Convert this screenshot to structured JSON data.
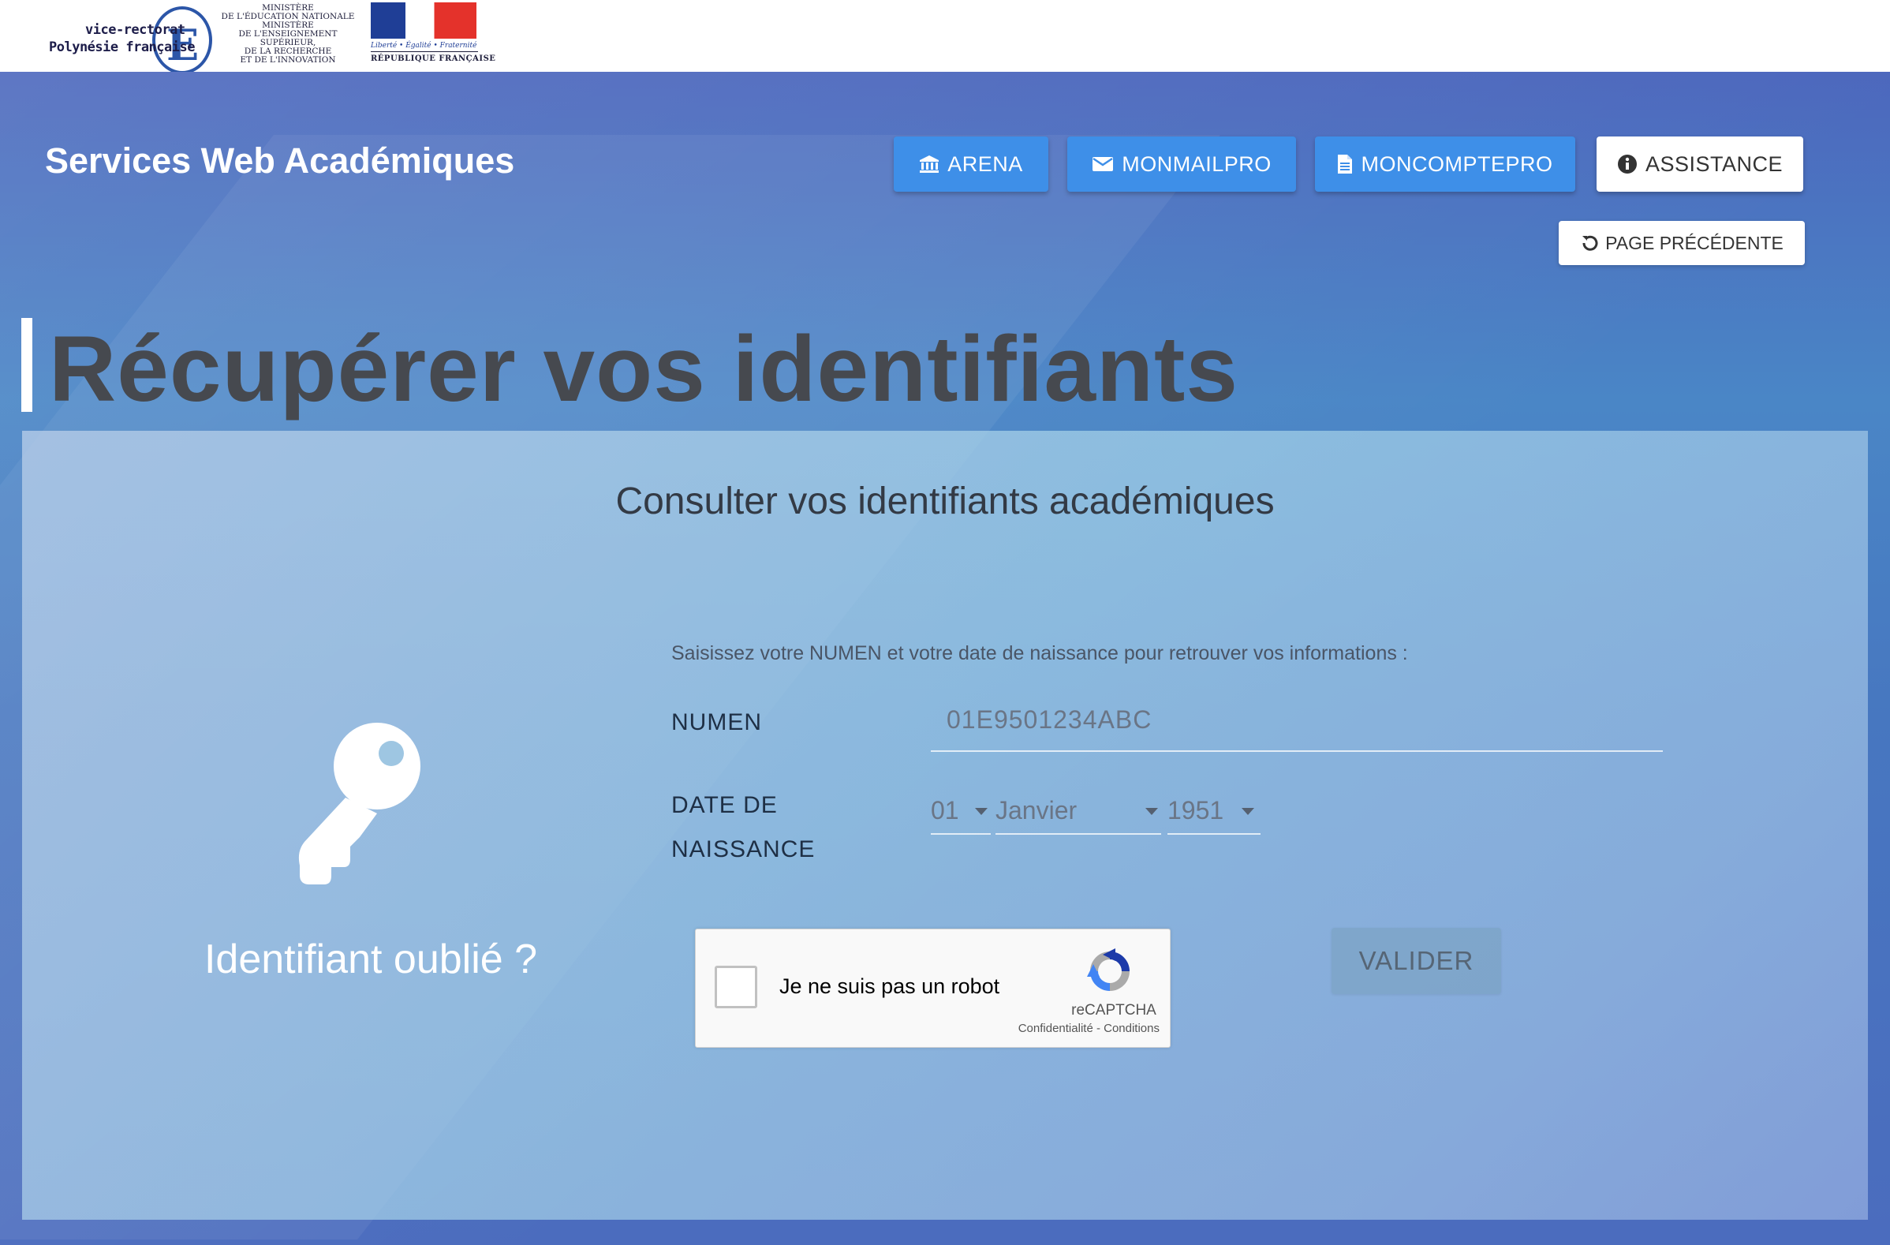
{
  "logos": {
    "vice_rectorat_line1": "vice-rectorat",
    "vice_rectorat_line2": "Polynésie française",
    "vice_rectorat_letter": "E",
    "ministere_text_1": "MINISTÈRE",
    "ministere_text_2": "DE L'ÉDUCATION NATIONALE",
    "ministere_text_3": "MINISTÈRE",
    "ministere_text_4": "DE L'ENSEIGNEMENT SUPÉRIEUR,",
    "ministere_text_5": "DE LA RECHERCHE",
    "ministere_text_6": "ET DE L'INNOVATION",
    "rf_motto": "Liberté • Égalité • Fraternité",
    "rf_name": "RÉPUBLIQUE FRANÇAISE"
  },
  "header": {
    "site_title": "Services Web Académiques",
    "nav": [
      {
        "label": "ARENA",
        "icon": "bank-icon",
        "style": "blue"
      },
      {
        "label": "MONMAILPRO",
        "icon": "envelope-icon",
        "style": "blue"
      },
      {
        "label": "MONCOMPTEPRO",
        "icon": "document-icon",
        "style": "blue"
      },
      {
        "label": "ASSISTANCE",
        "icon": "info-circle-icon",
        "style": "white"
      }
    ],
    "back_button": {
      "label": "PAGE PRÉCÉDENTE",
      "icon": "undo-icon"
    }
  },
  "page": {
    "title": "Récupérer vos identifiants"
  },
  "panel": {
    "subtitle": "Consulter vos identifiants académiques",
    "instruction": "Saisissez votre NUMEN et votre date de naissance pour retrouver vos informations :",
    "forgot_label": "Identifiant oublié ?",
    "key_icon": "key-icon",
    "numen_label": "NUMEN",
    "numen_value": "01E9501234ABC",
    "birthdate_label_1": "DATE DE",
    "birthdate_label_2": "NAISSANCE",
    "day": "01",
    "month": "Janvier",
    "year": "1951",
    "recaptcha": {
      "checkbox_label": "Je ne suis pas un robot",
      "brand": "reCAPTCHA",
      "links": "Confidentialité - Conditions"
    },
    "submit_label": "VALIDER"
  },
  "colors": {
    "nav_blue": "#3e8fe8",
    "hero_background": "#4a78c0",
    "title_gray": "#46494f"
  }
}
